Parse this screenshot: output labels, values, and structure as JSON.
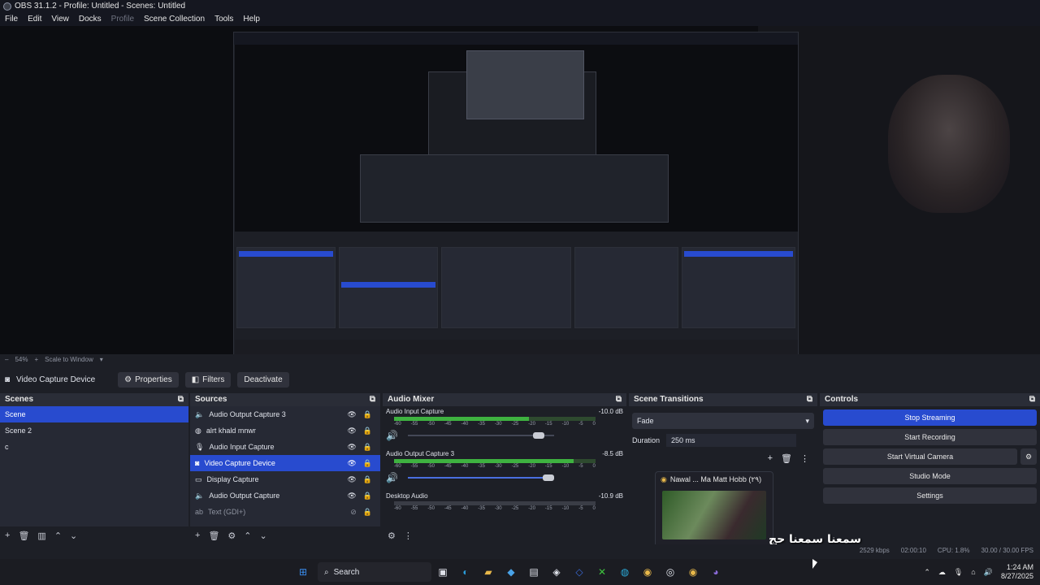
{
  "window": {
    "title": "OBS 31.1.2 - Profile: Untitled - Scenes: Untitled"
  },
  "menu": {
    "items": [
      "File",
      "Edit",
      "View",
      "Docks",
      "Profile",
      "Scene Collection",
      "Tools",
      "Help"
    ]
  },
  "zoom": {
    "level": "54%",
    "mode": "Scale to Window"
  },
  "source_toolbar": {
    "source_name": "Video Capture Device",
    "properties": "Properties",
    "filters": "Filters",
    "deactivate": "Deactivate"
  },
  "scenes": {
    "title": "Scenes",
    "items": [
      "Scene",
      "Scene 2",
      "c"
    ]
  },
  "sources": {
    "title": "Sources",
    "items": [
      "Audio Output Capture 3",
      "alrt khald mnwr",
      "Audio Input Capture",
      "Video Capture Device",
      "Display Capture",
      "Audio Output Capture",
      "Text (GDI+)"
    ]
  },
  "mixer": {
    "title": "Audio Mixer",
    "channels": [
      {
        "name": "Audio Input Capture",
        "db": "-10.0 dB",
        "level": 0.67,
        "volume": 0.93
      },
      {
        "name": "Audio Output Capture 3",
        "db": "-8.5 dB",
        "level": 0.89,
        "volume": 1.0
      },
      {
        "name": "Desktop Audio",
        "db": "-10.9 dB",
        "level": 0.0,
        "volume": 1.0
      }
    ],
    "ticks": [
      "-60",
      "-55",
      "-50",
      "-45",
      "-40",
      "-35",
      "-30",
      "-25",
      "-20",
      "-15",
      "-10",
      "-5",
      "0"
    ]
  },
  "transitions": {
    "title": "Scene Transitions",
    "selected": "Fade",
    "duration_label": "Duration",
    "duration_value": "250 ms"
  },
  "controls": {
    "title": "Controls",
    "buttons": [
      "Stop Streaming",
      "Start Recording",
      "Start Virtual Camera",
      "Studio Mode",
      "Settings"
    ]
  },
  "popup": {
    "title": "Nawal ... Ma Matt Hobb (٢٩)"
  },
  "overlay": {
    "text": "سمعنا سمعنا حج"
  },
  "status": {
    "time": "02:00:10",
    "cpu": "CPU: 1.8%",
    "fps": "30.00 / 30.00 FPS",
    "kbps": "2529 kbps"
  },
  "taskbar": {
    "search": "Search",
    "time": "1:24 AM",
    "date": "8/27/2025"
  },
  "colors": {
    "accent": "#284bcf",
    "bg": "#1d1f26",
    "panel": "#262934"
  }
}
